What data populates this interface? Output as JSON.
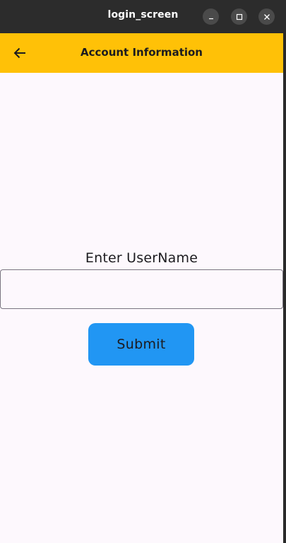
{
  "window": {
    "title": "login_screen",
    "buttons": {
      "minimize_icon": "minimize-icon",
      "maximize_icon": "maximize-icon",
      "close_icon": "close-icon"
    }
  },
  "appbar": {
    "title": "Account Information",
    "back_icon": "arrow-left-icon",
    "color": "#ffc107"
  },
  "form": {
    "label": "Enter UserName",
    "username_value": "",
    "submit_label": "Submit",
    "submit_color": "#2196f3"
  }
}
